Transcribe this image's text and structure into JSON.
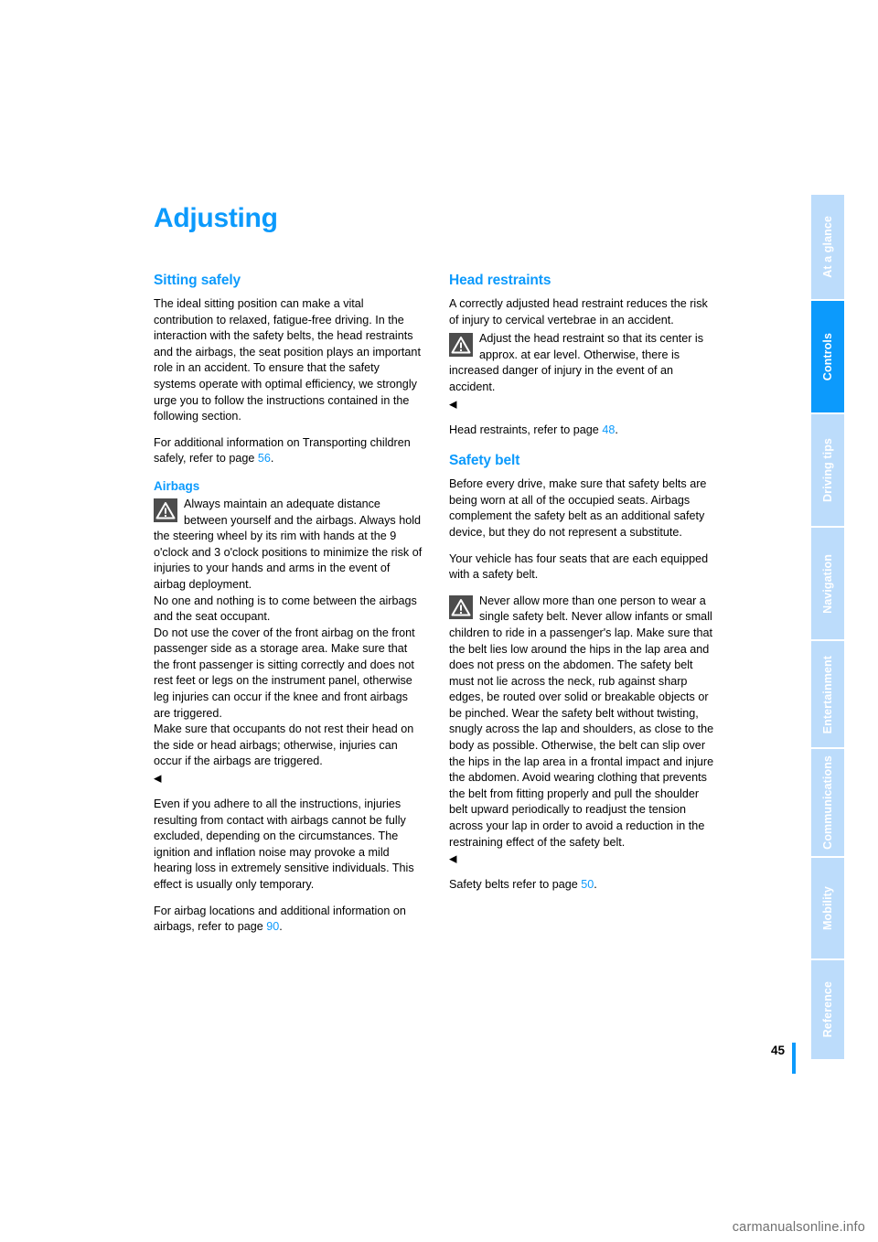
{
  "document": {
    "title": "Adjusting",
    "page_number": "45",
    "watermark": "carmanualsonline.info"
  },
  "sidebar": {
    "tabs": [
      {
        "label": "At a glance",
        "active": false
      },
      {
        "label": "Controls",
        "active": true
      },
      {
        "label": "Driving tips",
        "active": false
      },
      {
        "label": "Navigation",
        "active": false
      },
      {
        "label": "Entertainment",
        "active": false
      },
      {
        "label": "Communications",
        "active": false
      },
      {
        "label": "Mobility",
        "active": false
      },
      {
        "label": "Reference",
        "active": false
      }
    ]
  },
  "colors": {
    "accent_blue": "#0c9afc",
    "tab_inactive": "#bcdcfb",
    "warning_icon_bg": "#4d4d4d"
  },
  "left_column": {
    "section_heading": "Sitting safely",
    "intro_paragraph": "The ideal sitting position can make a vital contribution to relaxed, fatigue-free driving. In the interaction with the safety belts, the head restraints and the airbags, the seat position plays an important role in an accident. To ensure that the safety systems operate with optimal efficiency, we strongly urge you to follow the instructions contained in the following section.",
    "children_ref_before": "For additional information on Transporting children safely, refer to page ",
    "children_ref_page": "56",
    "children_ref_after": ".",
    "airbags_heading": "Airbags",
    "airbag_warning": "Always maintain an adequate distance between yourself and the airbags. Always hold the steering wheel by its rim with hands at the 9 o'clock and 3 o'clock positions to minimize the risk of injuries to your hands and arms in the event of airbag deployment.\nNo one and nothing is to come between the airbags and the seat occupant.\nDo not use the cover of the front airbag on the front passenger side as a storage area. Make sure that the front passenger is sitting correctly and does not rest feet or legs on the instrument panel, otherwise leg injuries can occur if the knee and front airbags are triggered.\nMake sure that occupants do not rest their head on the side or head airbags; otherwise, injuries can occur if the airbags are triggered.",
    "airbag_note": "Even if you adhere to all the instructions, injuries resulting from contact with airbags cannot be fully excluded, depending on the circumstances. The ignition and inflation noise may provoke a mild hearing loss in extremely sensitive individuals. This effect is usually only temporary.",
    "airbag_ref_before": "For airbag locations and additional information on airbags, refer to page ",
    "airbag_ref_page": "90",
    "airbag_ref_after": "."
  },
  "right_column": {
    "head_restraints_heading": "Head restraints",
    "head_restraints_intro": "A correctly adjusted head restraint reduces the risk of injury to cervical vertebrae in an accident.",
    "head_restraints_warning": "Adjust the head restraint so that its center is approx. at ear level. Otherwise, there is increased danger of injury in the event of an accident.",
    "head_restraints_ref_before": "Head restraints, refer to page ",
    "head_restraints_ref_page": "48",
    "head_restraints_ref_after": ".",
    "safety_belt_heading": "Safety belt",
    "safety_belt_intro": "Before every drive, make sure that safety belts are being worn at all of the occupied seats. Airbags complement the safety belt as an additional safety device, but they do not represent a substitute.",
    "safety_belt_seats": "Your vehicle has four seats that are each equipped with a safety belt.",
    "safety_belt_warning": "Never allow more than one person to wear a single safety belt. Never allow infants or small children to ride in a passenger's lap. Make sure that the belt lies low around the hips in the lap area and does not press on the abdomen. The safety belt must not lie across the neck, rub against sharp edges, be routed over solid or breakable objects or be pinched. Wear the safety belt without twisting, snugly across the lap and shoulders, as close to the body as possible. Otherwise, the belt can slip over the hips in the lap area in a frontal impact and injure the abdomen. Avoid wearing clothing that prevents the belt from fitting properly and pull the shoulder belt upward periodically to readjust the tension across your lap in order to avoid a reduction in the restraining effect of the safety belt.",
    "safety_belt_ref_before": "Safety belts refer to page ",
    "safety_belt_ref_page": "50",
    "safety_belt_ref_after": "."
  },
  "icons": {
    "warning_triangle": "warning-triangle-icon",
    "end_mark": "◀"
  }
}
